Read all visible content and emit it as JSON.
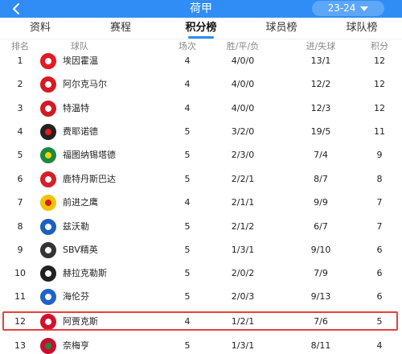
{
  "header": {
    "back_icon": "back-arrow-icon",
    "title": "荷甲",
    "season": "23-24"
  },
  "tabs": [
    {
      "label": "资料",
      "active": false
    },
    {
      "label": "赛程",
      "active": false
    },
    {
      "label": "积分榜",
      "active": true
    },
    {
      "label": "球员榜",
      "active": false
    },
    {
      "label": "球队榜",
      "active": false
    }
  ],
  "table": {
    "columns": {
      "rank": "排名",
      "team": "球队",
      "played": "场次",
      "wdl": "胜/平/负",
      "goals": "进/失球",
      "points": "积分"
    },
    "rows": [
      {
        "rank": "1",
        "team": "埃因霍温",
        "played": "4",
        "wdl": "4/0/0",
        "goals": "13/1",
        "points": "12",
        "logo_color": "#e31b23",
        "logo_accent": "#ffffff"
      },
      {
        "rank": "2",
        "team": "阿尔克马尔",
        "played": "4",
        "wdl": "4/0/0",
        "goals": "12/2",
        "points": "12",
        "logo_color": "#d71920",
        "logo_accent": "#ffffff"
      },
      {
        "rank": "3",
        "team": "特温特",
        "played": "4",
        "wdl": "4/0/0",
        "goals": "12/3",
        "points": "12",
        "logo_color": "#d11b24",
        "logo_accent": "#ffffff"
      },
      {
        "rank": "4",
        "team": "费耶诺德",
        "played": "5",
        "wdl": "3/2/0",
        "goals": "19/5",
        "points": "11",
        "logo_color": "#222222",
        "logo_accent": "#e31b23"
      },
      {
        "rank": "5",
        "team": "福图纳锡塔德",
        "played": "5",
        "wdl": "2/3/0",
        "goals": "7/4",
        "points": "9",
        "logo_color": "#1b8a3c",
        "logo_accent": "#f5d300"
      },
      {
        "rank": "6",
        "team": "鹿特丹斯巴达",
        "played": "5",
        "wdl": "2/2/1",
        "goals": "8/7",
        "points": "8",
        "logo_color": "#d4202a",
        "logo_accent": "#ffffff"
      },
      {
        "rank": "7",
        "team": "前进之鹰",
        "played": "4",
        "wdl": "2/1/1",
        "goals": "9/9",
        "points": "7",
        "logo_color": "#f2c200",
        "logo_accent": "#d71920"
      },
      {
        "rank": "8",
        "team": "兹沃勒",
        "played": "5",
        "wdl": "2/1/2",
        "goals": "6/7",
        "points": "7",
        "logo_color": "#1d5fbf",
        "logo_accent": "#ffffff"
      },
      {
        "rank": "9",
        "team": "SBV精英",
        "played": "5",
        "wdl": "1/3/1",
        "goals": "9/10",
        "points": "6",
        "logo_color": "#333333",
        "logo_accent": "#ffffff"
      },
      {
        "rank": "10",
        "team": "赫拉克勒斯",
        "played": "5",
        "wdl": "2/0/2",
        "goals": "7/9",
        "points": "6",
        "logo_color": "#222222",
        "logo_accent": "#ffffff"
      },
      {
        "rank": "11",
        "team": "海伦芬",
        "played": "5",
        "wdl": "2/0/3",
        "goals": "9/13",
        "points": "6",
        "logo_color": "#1e63c7",
        "logo_accent": "#ffffff"
      },
      {
        "rank": "12",
        "team": "阿贾克斯",
        "played": "4",
        "wdl": "1/2/1",
        "goals": "7/6",
        "points": "5",
        "logo_color": "#d2122e",
        "logo_accent": "#ffffff"
      },
      {
        "rank": "13",
        "team": "奈梅亨",
        "played": "5",
        "wdl": "1/3/1",
        "goals": "8/11",
        "points": "4",
        "logo_color": "#c8102e",
        "logo_accent": "#1b8a3c"
      }
    ],
    "highlighted_rank": "12"
  },
  "colors": {
    "primary": "#2f8df5",
    "highlight_border": "#e9403e"
  }
}
